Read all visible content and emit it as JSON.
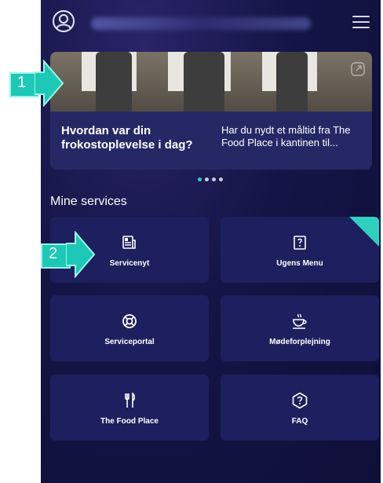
{
  "banner": {
    "left_title": "Hvordan var din frokostoplevelse i dag?",
    "right_text": "Har du nydt et måltid fra The Food Place i kantinen til..."
  },
  "carousel": {
    "total": 4,
    "active_index": 0
  },
  "section_title": "Mine services",
  "tiles": [
    {
      "label": "Servicenyt",
      "icon": "newspaper-icon"
    },
    {
      "label": "Ugens Menu",
      "icon": "menu-book-icon"
    },
    {
      "label": "Serviceportal",
      "icon": "lifebuoy-icon"
    },
    {
      "label": "Mødeforplejning",
      "icon": "coffee-cup-icon"
    },
    {
      "label": "The Food Place",
      "icon": "fork-knife-icon"
    },
    {
      "label": "FAQ",
      "icon": "question-icon"
    }
  ],
  "callouts": [
    {
      "label": "1"
    },
    {
      "label": "2"
    }
  ],
  "colors": {
    "background": "#141546",
    "tile": "#1e1f5e",
    "accent": "#2fd0c0"
  }
}
